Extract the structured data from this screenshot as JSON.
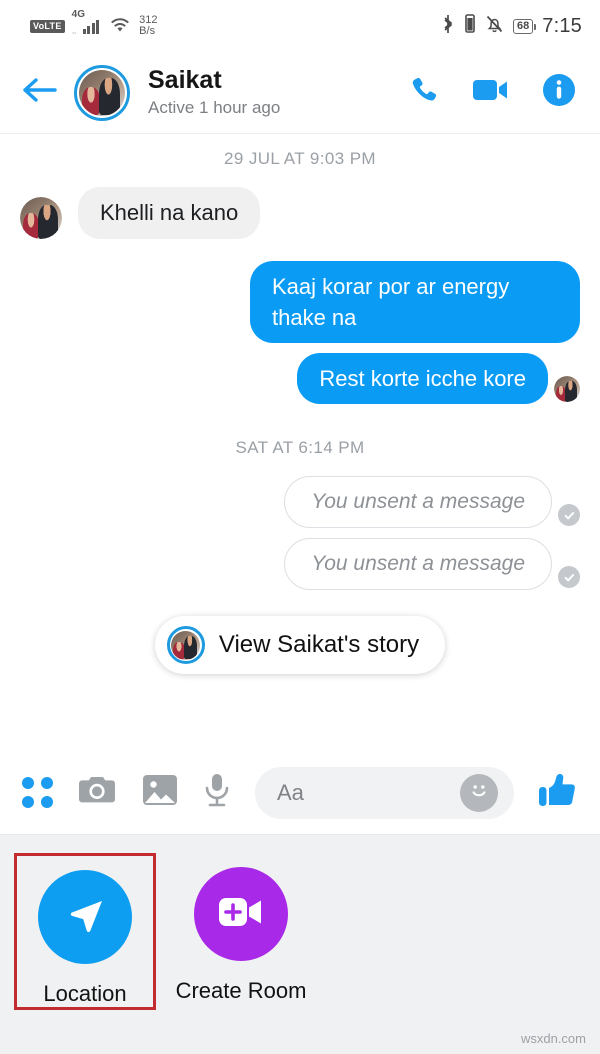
{
  "status_bar": {
    "volte": "VoLTE",
    "network_type": "4G",
    "data_speed_value": "312",
    "data_speed_unit": "B/s",
    "battery_level": "68",
    "time": "7:15",
    "icons": [
      "volte-badge",
      "signal-bars-icon",
      "wifi-icon",
      "bluetooth-icon",
      "vibrate-icon",
      "silent-bell-icon",
      "battery-icon"
    ]
  },
  "header": {
    "back_icon": "back-arrow-icon",
    "contact_name": "Saikat",
    "active_status": "Active 1 hour ago",
    "actions": [
      {
        "name": "voice-call-button",
        "icon": "phone-icon"
      },
      {
        "name": "video-call-button",
        "icon": "video-camera-icon"
      },
      {
        "name": "conversation-info-button",
        "icon": "info-icon"
      }
    ],
    "avatar_ring_color": "#1e9ae0"
  },
  "conversation": {
    "day_divider_1": "29 JUL AT 9:03 PM",
    "day_divider_2": "SAT AT 6:14 PM",
    "messages": [
      {
        "id": "m1",
        "direction": "incoming",
        "text": "Khelli na kano",
        "has_avatar": true
      },
      {
        "id": "m2",
        "direction": "outgoing",
        "text": "Kaaj korar por ar energy thake na",
        "has_avatar": false
      },
      {
        "id": "m3",
        "direction": "outgoing",
        "text": "Rest korte icche kore",
        "has_avatar": true
      },
      {
        "id": "m4",
        "direction": "outgoing",
        "text": "You unsent a message",
        "unsent": true,
        "seen": true
      },
      {
        "id": "m5",
        "direction": "outgoing",
        "text": "You unsent a message",
        "unsent": true,
        "seen": true
      }
    ],
    "story_button_label": "View Saikat's story"
  },
  "input_bar": {
    "placeholder": "Aa",
    "tools": [
      {
        "name": "more-apps-button",
        "icon": "four-dots-grid-icon"
      },
      {
        "name": "camera-button",
        "icon": "camera-icon"
      },
      {
        "name": "gallery-button",
        "icon": "image-icon"
      },
      {
        "name": "voice-message-button",
        "icon": "microphone-icon"
      }
    ],
    "emoji_button_icon": "smiley-face-icon",
    "like_button_icon": "thumbs-up-icon"
  },
  "action_sheet": {
    "items": [
      {
        "name": "location-button",
        "label": "Location",
        "icon": "send-location-arrow-icon",
        "color": "#0d9ef2",
        "highlighted": true
      },
      {
        "name": "create-room-button",
        "label": "Create Room",
        "icon": "video-room-plus-icon",
        "color": "#a829e8",
        "highlighted": false
      }
    ],
    "highlight_color": "#c22b30"
  },
  "watermark": "wsxdn.com",
  "colors": {
    "outgoing_bubble": "#0a9bf5",
    "incoming_bubble": "#f0f0f0",
    "accent": "#0d9ef2",
    "sheet_background": "#f0f1f2"
  }
}
